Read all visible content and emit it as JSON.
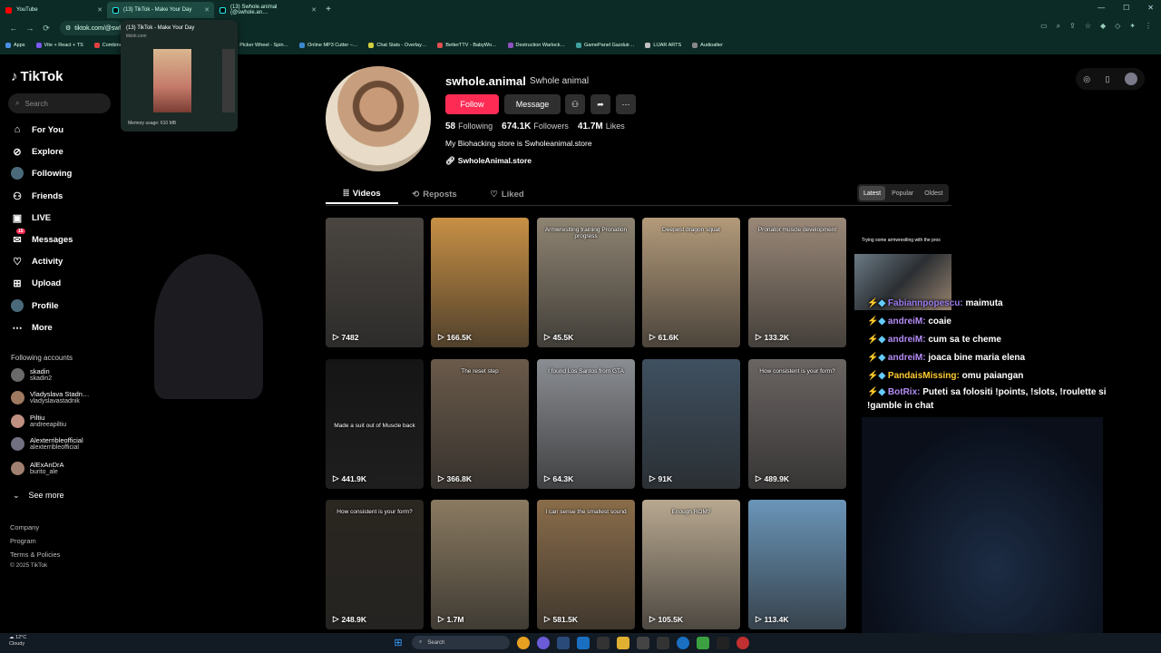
{
  "browser": {
    "tabs": [
      {
        "title": "YouTube",
        "color": "#ff0000"
      },
      {
        "title": "(13) TikTok - Make Your Day",
        "color": "#000000"
      },
      {
        "title": "(13) Swhole.animal (@swhole.an…",
        "color": "#000000"
      }
    ],
    "new_tab": "+",
    "url": "tiktok.com/@swh",
    "bookmarks": [
      "Apps",
      "Vite + React + TS",
      "Combine PDF – Onli…",
      "Y2Mate – Youtube t…",
      "Picker Wheel - Spin…",
      "Online MP3 Cutter –…",
      "Chat Stats - Overlay…",
      "BetterTTV - BabyWo…",
      "Destruction Warlock…",
      "GamePanel Gazduir…",
      "LIJAR ARTS",
      "Audioalter"
    ],
    "hovercard": {
      "title": "(13) TikTok - Make Your Day",
      "domain": "tiktok.com",
      "memory": "Memory usage: 610 MB"
    }
  },
  "sidebar": {
    "logo": "TikTok",
    "search_placeholder": "Search",
    "items": [
      {
        "label": "For You",
        "icon": "home-icon"
      },
      {
        "label": "Explore",
        "icon": "compass-icon"
      },
      {
        "label": "Following",
        "icon": "following-avatar-icon"
      },
      {
        "label": "Friends",
        "icon": "friends-icon"
      },
      {
        "label": "LIVE",
        "icon": "live-icon"
      },
      {
        "label": "Messages",
        "icon": "messages-icon",
        "badge": "15"
      },
      {
        "label": "Activity",
        "icon": "activity-icon"
      },
      {
        "label": "Upload",
        "icon": "upload-icon"
      },
      {
        "label": "Profile",
        "icon": "profile-icon"
      },
      {
        "label": "More",
        "icon": "more-icon"
      }
    ],
    "following_header": "Following accounts",
    "following": [
      {
        "name": "skadin",
        "handle": "skadin2"
      },
      {
        "name": "Vladyslava Stadn…",
        "handle": "vladyslavastadnik"
      },
      {
        "name": "Piltiu",
        "handle": "andreeapiltiu"
      },
      {
        "name": "Alexterribleofficial",
        "handle": "alexterribleofficial"
      },
      {
        "name": "AlExAnDrA",
        "handle": "burito_ale"
      }
    ],
    "see_more": "See more",
    "footer": [
      "Company",
      "Program",
      "Terms & Policies",
      "© 2025 TikTok"
    ]
  },
  "profile": {
    "username": "swhole.animal",
    "nickname": "Swhole animal",
    "follow": "Follow",
    "message": "Message",
    "stats": {
      "following": "58",
      "following_label": "Following",
      "followers": "674.1K",
      "followers_label": "Followers",
      "likes": "41.7M",
      "likes_label": "Likes"
    },
    "bio": "My Biohacking store is Swholeanimal.store",
    "link": "SwholeAnimal.store",
    "tabs": [
      "Videos",
      "Reposts",
      "Liked"
    ],
    "sort": [
      "Latest",
      "Popular",
      "Oldest"
    ]
  },
  "videos": [
    {
      "views": "7482",
      "caption": "",
      "bg": "#4a4540"
    },
    {
      "views": "166.5K",
      "caption": "",
      "bg": "#c89045"
    },
    {
      "views": "45.5K",
      "caption": "Armwrestling training Pronation progress",
      "bg": "#8f8472"
    },
    {
      "views": "61.6K",
      "caption": "Deepest dragon squat",
      "bg": "#b39a7a"
    },
    {
      "views": "133.2K",
      "caption": "Pronator muscle development",
      "bg": "#9a8878"
    },
    {
      "views": "441.9K",
      "caption": "Made a suit out of Muscle back",
      "bg": "#151515"
    },
    {
      "views": "366.8K",
      "caption": "The reset step",
      "bg": "#6a5a4a"
    },
    {
      "views": "64.3K",
      "caption": "I found Los Santos from GTA",
      "bg": "#8a8d92"
    },
    {
      "views": "91K",
      "caption": "",
      "bg": "#3f5060"
    },
    {
      "views": "489.9K",
      "caption": "How consistent is your form?",
      "bg": "#6a6462"
    },
    {
      "views": "248.9K",
      "caption": "How consistent is your form?",
      "bg": "#2a2620"
    },
    {
      "views": "1.7M",
      "caption": "",
      "bg": "#8a7a60"
    },
    {
      "views": "581.5K",
      "caption": "I can sense the smallest sound",
      "bg": "#8a6d4a"
    },
    {
      "views": "105.5K",
      "caption": "Enough ROM?",
      "bg": "#b8a890"
    },
    {
      "views": "113.4K",
      "caption": "",
      "bg": "#6a95b8"
    }
  ],
  "overlay": {
    "title": "Trying some armwrestling with the pros",
    "chat": [
      {
        "user": "Fabiannpopescu:",
        "msg": "maimuta"
      },
      {
        "user": "andreiM:",
        "msg": "coaie"
      },
      {
        "user": "andreiM:",
        "msg": "cum sa te cheme"
      },
      {
        "user": "andreiM:",
        "msg": "joaca bine maria elena"
      },
      {
        "user": "PandaisMissing:",
        "msg": "omu paiangan"
      },
      {
        "user": "BotRix:",
        "msg": "Puteti sa folositi !points, !slots, !roulette si !gamble in chat"
      }
    ]
  },
  "taskbar": {
    "temp": "12°C",
    "condition": "Cloudy",
    "search": "Search"
  }
}
